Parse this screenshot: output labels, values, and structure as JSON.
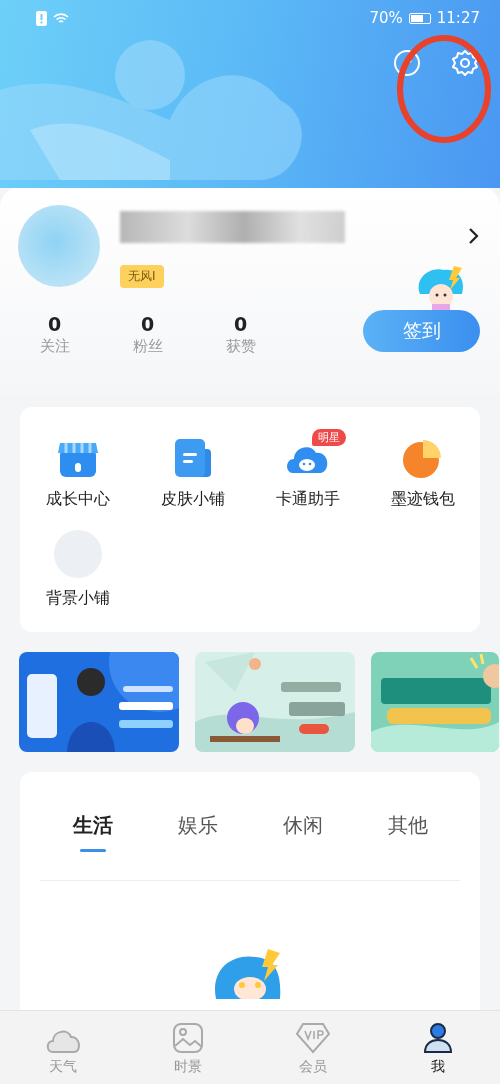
{
  "status_bar": {
    "battery_text": "70%",
    "time": "11:27"
  },
  "profile": {
    "tag": "无风I",
    "stats": [
      {
        "value": "0",
        "label": "关注"
      },
      {
        "value": "0",
        "label": "粉丝"
      },
      {
        "value": "0",
        "label": "获赞"
      }
    ],
    "checkin_button": "签到"
  },
  "services": [
    {
      "kind": "shop",
      "label": "成长中心"
    },
    {
      "kind": "skin",
      "label": "皮肤小铺"
    },
    {
      "kind": "cartoon",
      "label": "卡通助手",
      "badge": "明星"
    },
    {
      "kind": "wallet",
      "label": "墨迹钱包"
    },
    {
      "kind": "blank",
      "label": "背景小铺"
    }
  ],
  "tabs": [
    {
      "label": "生活",
      "selected": true
    },
    {
      "label": "娱乐",
      "selected": false
    },
    {
      "label": "休闲",
      "selected": false
    },
    {
      "label": "其他",
      "selected": false
    }
  ],
  "bottom_nav": [
    {
      "kind": "weather",
      "label": "天气",
      "selected": false
    },
    {
      "kind": "scene",
      "label": "时景",
      "selected": false
    },
    {
      "kind": "vip",
      "label": "会员",
      "selected": false
    },
    {
      "kind": "me",
      "label": "我",
      "selected": true
    }
  ]
}
